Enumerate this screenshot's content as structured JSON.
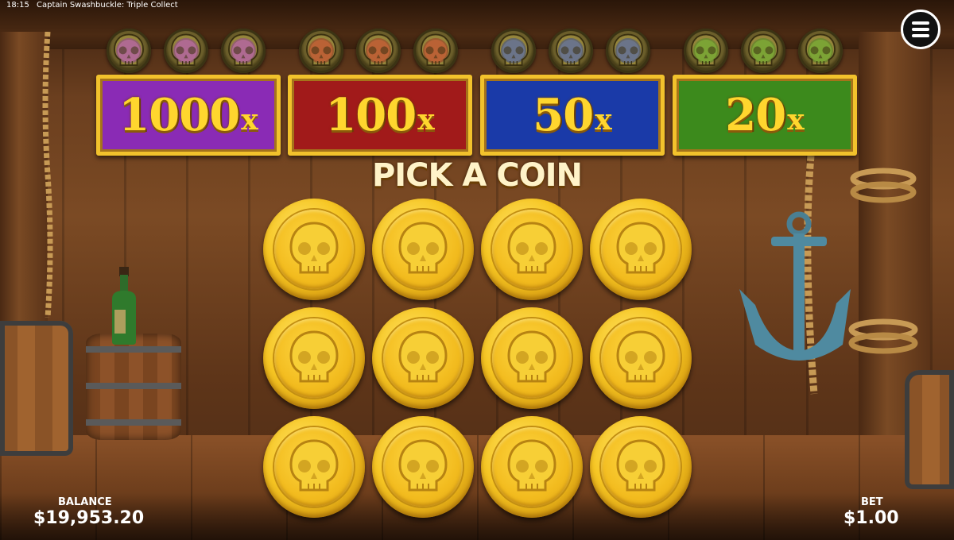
{
  "status_bar": {
    "time": "18:15",
    "title": "Captain Swashbuckle: Triple Collect"
  },
  "menu": {
    "icon": "hamburger-icon"
  },
  "jackpot_tiers": [
    {
      "id": "purple",
      "value": "1000",
      "suffix": "x",
      "color": "#8a2bb5",
      "token_color": "#9b2fc7",
      "tokens_collected": 0,
      "tokens_total": 3
    },
    {
      "id": "red",
      "value": "100",
      "suffix": "x",
      "color": "#a11a1a",
      "token_color": "#b02020",
      "tokens_collected": 0,
      "tokens_total": 3
    },
    {
      "id": "blue",
      "value": "50",
      "suffix": "x",
      "color": "#1a3aa8",
      "token_color": "#1f40b8",
      "tokens_collected": 0,
      "tokens_total": 3
    },
    {
      "id": "green",
      "value": "20",
      "suffix": "x",
      "color": "#3c8a1c",
      "token_color": "#3f9520",
      "tokens_collected": 0,
      "tokens_total": 3
    }
  ],
  "prompt": "PICK A COIN",
  "coins": {
    "rows": 3,
    "cols": 4,
    "icon": "skull-icon",
    "state": "unrevealed"
  },
  "hud": {
    "balance_label": "BALANCE",
    "balance_value": "$19,953.20",
    "bet_label": "BET",
    "bet_value": "$1.00"
  }
}
